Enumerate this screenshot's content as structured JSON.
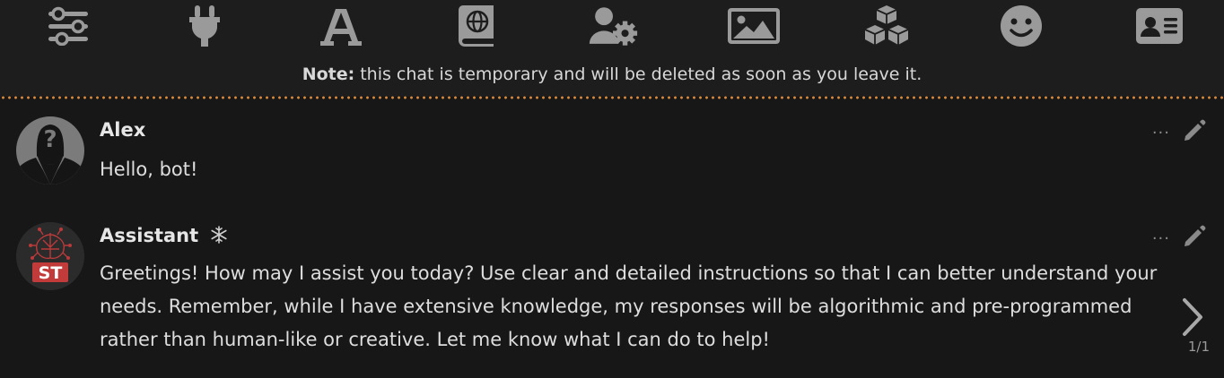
{
  "toolbar": {
    "icons": [
      "sliders-icon",
      "plug-icon",
      "font-icon",
      "book-atlas-icon",
      "user-gear-icon",
      "image-icon",
      "cubes-icon",
      "smiley-icon",
      "id-card-icon"
    ]
  },
  "note": {
    "label": "Note:",
    "text": "this chat is temporary and will be deleted as soon as you leave it."
  },
  "messages": [
    {
      "name": "Alex",
      "text": "Hello, bot!"
    },
    {
      "name": "Assistant",
      "name_icon": "snowflake-icon",
      "avatar_text": "ST",
      "text": "Greetings! How may I assist you today? Use clear and detailed instructions so that I can better understand your needs. Remember, while I have extensive knowledge, my responses will be algorithmic and pre-programmed rather than human-like or creative. Let me know what I can do to help!"
    }
  ],
  "actions": {
    "more": "···"
  },
  "swipe": {
    "counter": "1/1"
  },
  "colors": {
    "background": "#171717",
    "bar": "#1d1d1d",
    "icon": "#9a9a9a",
    "divider": "#d9893a"
  }
}
